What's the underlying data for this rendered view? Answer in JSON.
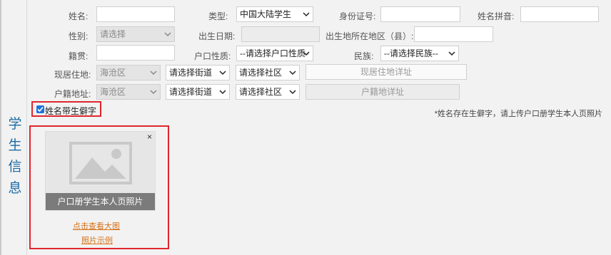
{
  "section_title": [
    "学",
    "生",
    "信",
    "息"
  ],
  "fields": {
    "name_label": "姓名:",
    "type_label": "类型:",
    "type_value": "中国大陆学生",
    "id_label": "身份证号:",
    "pinyin_label": "姓名拼音:",
    "gender_label": "性别:",
    "gender_value": "请选择",
    "birthdate_label": "出生日期:",
    "birthplace_label": "出生地所在地区（县）:",
    "native_label": "籍贯:",
    "hukou_type_label": "户口性质:",
    "hukou_type_value": "--请选择户口性质-",
    "ethnic_label": "民族:",
    "ethnic_value": "--请选择民族--",
    "residence_label": "现居住地:",
    "residence_district": "海沧区",
    "residence_street": "请选择街道",
    "residence_community": "请选择社区",
    "residence_detail": "现居住地详址",
    "hukou_addr_label": "户籍地址:",
    "hukou_district": "海沧区",
    "hukou_street": "请选择街道",
    "hukou_community": "请选择社区",
    "hukou_detail": "户籍地详址"
  },
  "rare_char": {
    "label": "姓名带生僻字",
    "note": "*姓名存在生僻字，请上传户口册学生本人页照片"
  },
  "upload": {
    "close": "×",
    "caption": "户口册学生本人页照片",
    "view_link": "点击查看大图",
    "example_link": "照片示例"
  }
}
